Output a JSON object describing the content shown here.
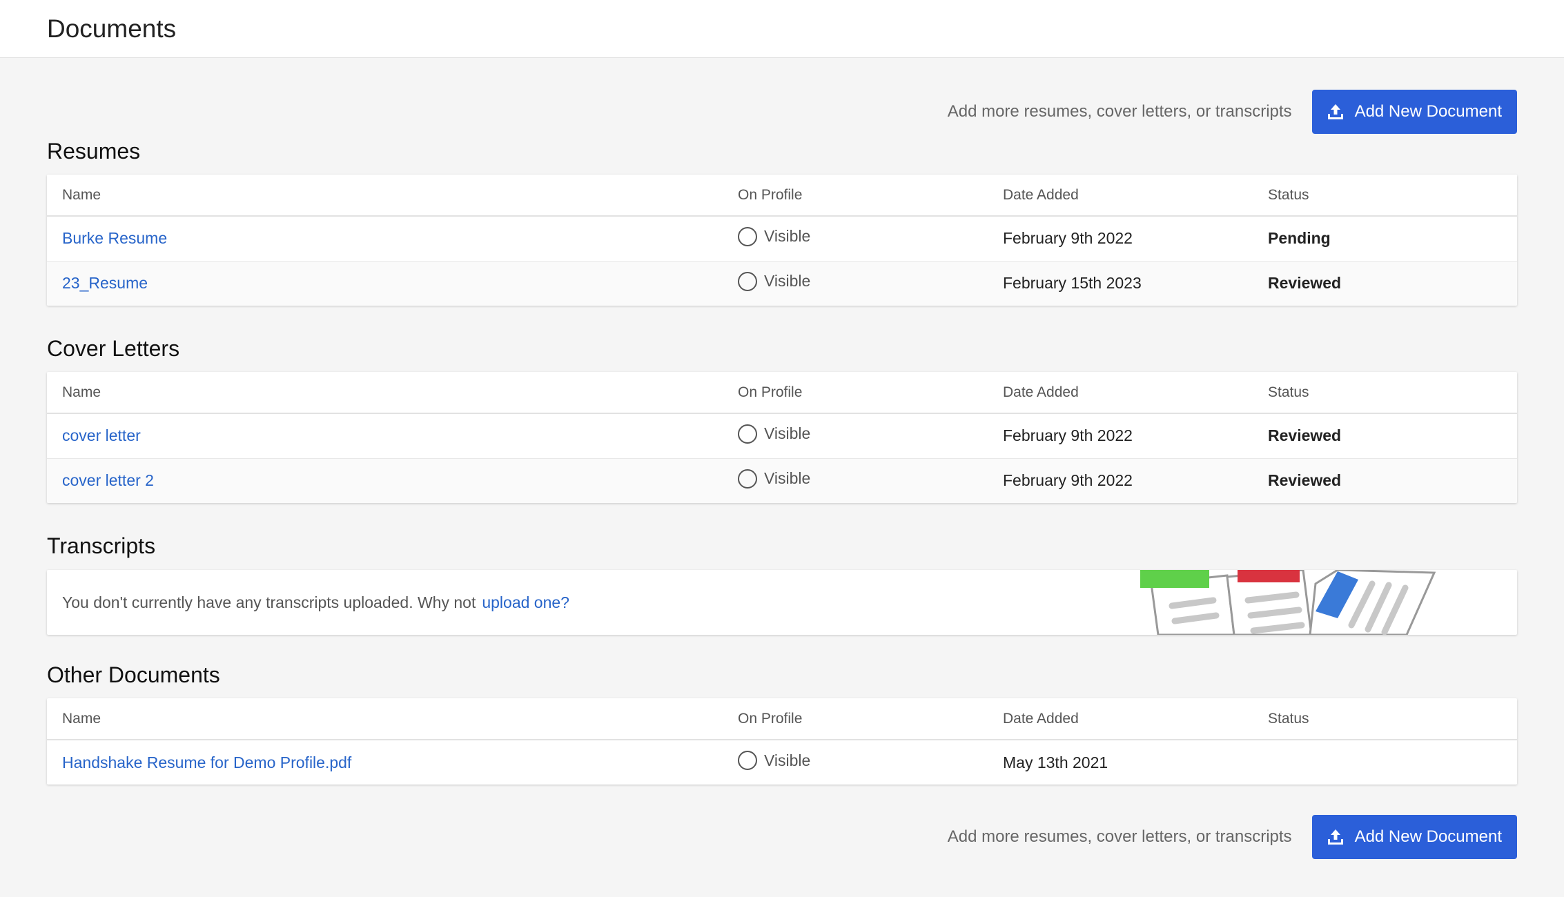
{
  "header": {
    "title": "Documents"
  },
  "add_row": {
    "hint": "Add more resumes, cover letters, or transcripts",
    "button_label": "Add New Document"
  },
  "columns": {
    "name": "Name",
    "on_profile": "On Profile",
    "date_added": "Date Added",
    "status": "Status"
  },
  "visible_label": "Visible",
  "resumes": {
    "title": "Resumes",
    "rows": [
      {
        "name": "Burke Resume",
        "date": "February 9th 2022",
        "status": "Pending"
      },
      {
        "name": "23_Resume",
        "date": "February 15th 2023",
        "status": "Reviewed"
      }
    ]
  },
  "cover_letters": {
    "title": "Cover Letters",
    "rows": [
      {
        "name": "cover letter",
        "date": "February 9th 2022",
        "status": "Reviewed"
      },
      {
        "name": "cover letter 2",
        "date": "February 9th 2022",
        "status": "Reviewed"
      }
    ]
  },
  "transcripts": {
    "title": "Transcripts",
    "empty_text": "You don't currently have any transcripts uploaded. Why not",
    "upload_link": "upload one?"
  },
  "other_documents": {
    "title": "Other Documents",
    "rows": [
      {
        "name": "Handshake Resume for Demo Profile.pdf",
        "date": "May 13th 2021",
        "status": ""
      }
    ]
  },
  "colors": {
    "primary": "#2b5fd9",
    "link": "#2764c9"
  }
}
